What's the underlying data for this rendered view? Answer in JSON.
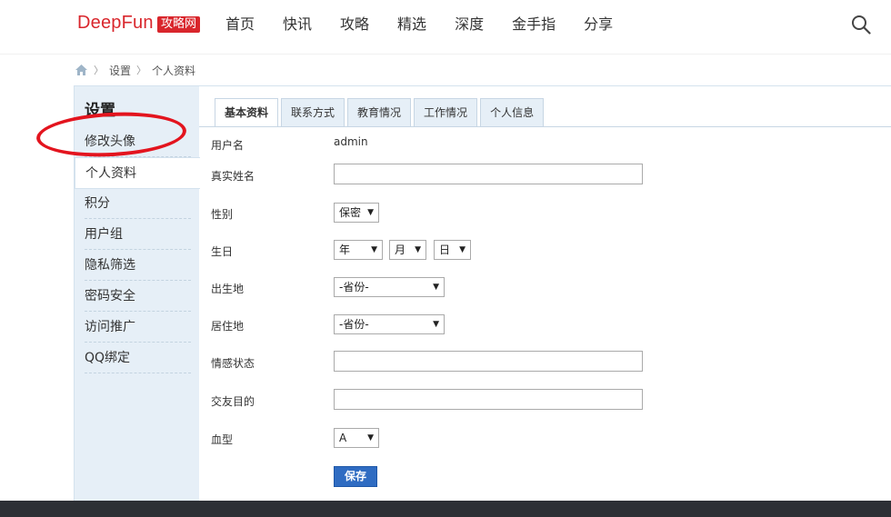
{
  "header": {
    "logo": "DeepFun",
    "logo_badge": "攻略网",
    "nav": [
      "首页",
      "快讯",
      "攻略",
      "精选",
      "深度",
      "金手指",
      "分享"
    ]
  },
  "breadcrumb": {
    "items": [
      "设置",
      "个人资料"
    ]
  },
  "sidebar": {
    "title": "设置",
    "items": [
      "修改头像",
      "个人资料",
      "积分",
      "用户组",
      "隐私筛选",
      "密码安全",
      "访问推广",
      "QQ绑定"
    ]
  },
  "tabs": [
    "基本资料",
    "联系方式",
    "教育情况",
    "工作情况",
    "个人信息"
  ],
  "form": {
    "username_label": "用户名",
    "username_value": "admin",
    "realname_label": "真实姓名",
    "gender_label": "性别",
    "gender_value": "保密",
    "birthday_label": "生日",
    "birth_year": "年",
    "birth_month": "月",
    "birth_day": "日",
    "birthplace_label": "出生地",
    "birthplace_value": "-省份-",
    "residence_label": "居住地",
    "residence_value": "-省份-",
    "emotion_label": "情感状态",
    "purpose_label": "交友目的",
    "blood_label": "血型",
    "blood_value": "A",
    "save_label": "保存"
  },
  "colors": {
    "brand": "#d9262c",
    "sidebar_bg": "#e6eff7",
    "button": "#2f6cc2",
    "annotation": "#e3141e"
  }
}
